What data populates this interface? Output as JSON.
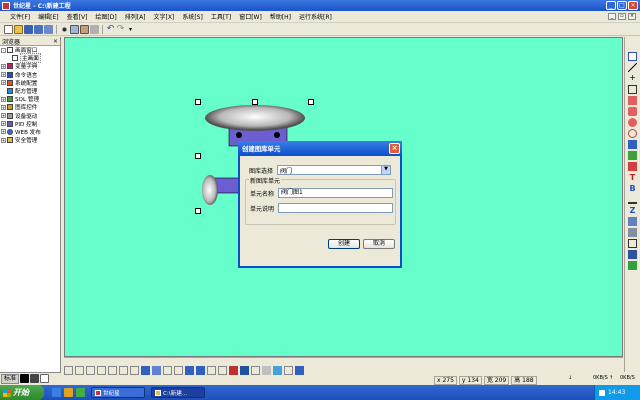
{
  "window": {
    "title": "世纪星 - C:\\新建工程"
  },
  "menu": [
    "文件[F]",
    "编辑[E]",
    "查看[V]",
    "绘图[D]",
    "排列[A]",
    "文字[X]",
    "系统[S]",
    "工具[T]",
    "窗口[W]",
    "帮助[H]",
    "运行系统[R]"
  ],
  "explorer": {
    "title": "浏览器",
    "items": [
      {
        "label": "画面窗口",
        "expand": "-",
        "child": false
      },
      {
        "label": "主画面",
        "expand": "",
        "child": true
      },
      {
        "label": "变量字典",
        "expand": "+",
        "child": false
      },
      {
        "label": "命令语言",
        "expand": "+",
        "child": false
      },
      {
        "label": "系统配置",
        "expand": "+",
        "child": false
      },
      {
        "label": "配方管理",
        "expand": "",
        "child": false
      },
      {
        "label": "SQL 管理",
        "expand": "+",
        "child": false
      },
      {
        "label": "图库控件",
        "expand": "+",
        "child": false
      },
      {
        "label": "设备驱动",
        "expand": "+",
        "child": false
      },
      {
        "label": "PID 控制",
        "expand": "+",
        "child": false
      },
      {
        "label": "WEB 发布",
        "expand": "+",
        "child": false
      },
      {
        "label": "安全管理",
        "expand": "+",
        "child": false
      }
    ],
    "tabs": [
      "标准"
    ]
  },
  "dialog": {
    "title": "创建图库单元",
    "library_label": "图库选择",
    "library_value": "阀门",
    "group_label": "新图库单元",
    "name_label": "单元名称",
    "name_value": "阀门图1",
    "desc_label": "单元说明",
    "desc_value": "",
    "create_button": "创建",
    "cancel_button": "取消"
  },
  "status": {
    "x": "x 275",
    "y": "y 134",
    "w": "宽 209",
    "h": "高 188"
  },
  "network": {
    "down": "0KB/S",
    "up": "0KB/S"
  },
  "taskbar": {
    "start": "开始",
    "tasks": [
      "世纪星",
      "C:\\新建..."
    ],
    "time": "14:43"
  },
  "colors": {
    "canvas": "#66FFCC",
    "titlebar": "#1C53C8"
  }
}
